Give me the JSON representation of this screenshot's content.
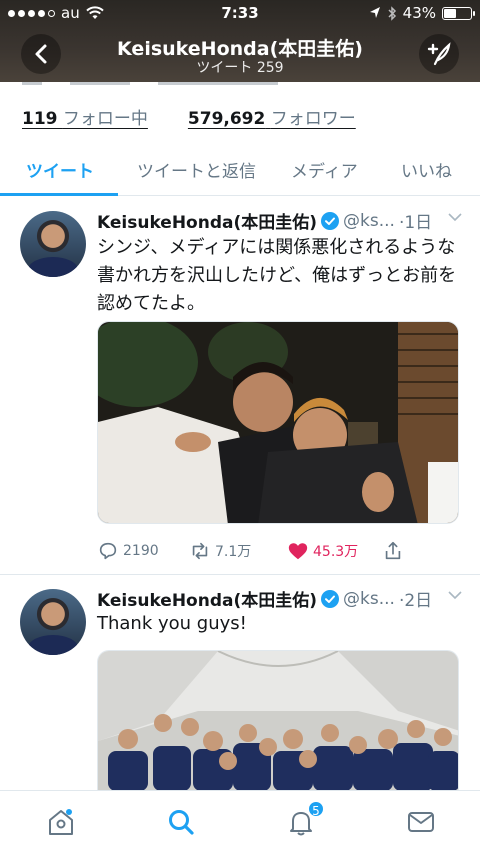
{
  "status_bar": {
    "carrier": "au",
    "time": "7:33",
    "battery": "43%",
    "battery_level": 0.43
  },
  "nav": {
    "title": "KeisukeHonda(本田圭佑)",
    "subtitle": "ツイート 259",
    "back_icon": "chevron-left-icon",
    "compose_icon": "compose-icon"
  },
  "profile": {
    "following_count": "119",
    "following_label": "フォロー中",
    "followers_count": "579,692",
    "followers_label": "フォロワー"
  },
  "tabs": [
    {
      "label": "ツイート",
      "active": true
    },
    {
      "label": "ツイートと返信",
      "active": false
    },
    {
      "label": "メディア",
      "active": false
    },
    {
      "label": "いいね",
      "active": false
    }
  ],
  "tweets": [
    {
      "name": "KeisukeHonda(本田圭佑)",
      "handle": "@ks...",
      "time": "·1日",
      "text": "シンジ、メディアには関係悪化されるような書かれ方を沢山したけど、俺はずっとお前を認めてたよ。",
      "replies": "2190",
      "retweets": "7.1万",
      "likes": "45.3万",
      "liked": true
    },
    {
      "name": "KeisukeHonda(本田圭佑)",
      "handle": "@ks...",
      "time": "·2日",
      "text": "Thank you guys!"
    }
  ],
  "bottom_bar": {
    "items": [
      "home-icon",
      "search-icon",
      "notifications-icon",
      "messages-icon"
    ],
    "active": "search-icon",
    "notification_badge": "5"
  },
  "colors": {
    "accent": "#1da1f2",
    "like": "#e0245e",
    "muted": "#657786",
    "header_bg": "#3b3530"
  }
}
